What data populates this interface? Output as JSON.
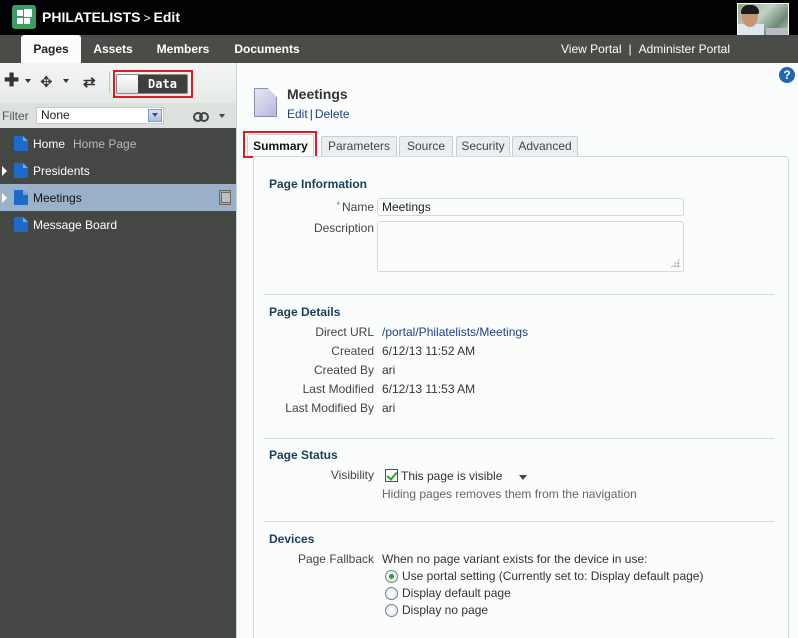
{
  "header": {
    "site_name": "PHILATELISTS",
    "separator": ">",
    "mode": "Edit",
    "logo_icon": "portal-grid-icon",
    "avatar": "user-avatar-photo"
  },
  "nav": {
    "tabs": [
      {
        "label": "Pages",
        "active": true
      },
      {
        "label": "Assets",
        "active": false
      },
      {
        "label": "Members",
        "active": false
      },
      {
        "label": "Documents",
        "active": false
      }
    ],
    "view_portal": "View Portal",
    "divider": "|",
    "administer_portal": "Administer Portal"
  },
  "left_panel": {
    "toolbar": {
      "add_icon": "plus-icon",
      "move_icon": "move-arrows-icon",
      "refresh_icon": "refresh-icon",
      "data_toggle_label": "Data"
    },
    "filter": {
      "label": "Filter",
      "selected": "None",
      "view_icon": "glasses-icon"
    },
    "tree": [
      {
        "label": "Home",
        "sublabel": "Home Page",
        "expandable": false,
        "selected": false
      },
      {
        "label": "Presidents",
        "sublabel": "",
        "expandable": true,
        "selected": false
      },
      {
        "label": "Meetings",
        "sublabel": "",
        "expandable": true,
        "selected": true,
        "device_icon": "device-tablet-icon"
      },
      {
        "label": "Message Board",
        "sublabel": "",
        "expandable": false,
        "selected": false
      }
    ]
  },
  "main": {
    "help_label": "?",
    "page_title": "Meetings",
    "actions": {
      "edit": "Edit",
      "separator": "|",
      "delete": "Delete"
    },
    "tabs": [
      {
        "label": "Summary",
        "active": true
      },
      {
        "label": "Parameters",
        "active": false
      },
      {
        "label": "Source",
        "active": false
      },
      {
        "label": "Security",
        "active": false
      },
      {
        "label": "Advanced",
        "active": false
      }
    ],
    "page_information": {
      "title": "Page Information",
      "required_marker": "*",
      "name_label": "Name",
      "name_value": "Meetings",
      "description_label": "Description",
      "description_value": ""
    },
    "page_details": {
      "title": "Page Details",
      "rows": [
        {
          "label": "Direct URL",
          "value": "/portal/Philatelists/Meetings",
          "link": true
        },
        {
          "label": "Created",
          "value": "6/12/13 11:52 AM",
          "link": false
        },
        {
          "label": "Created By",
          "value": "ari",
          "link": false
        },
        {
          "label": "Last Modified",
          "value": "6/12/13 11:53 AM",
          "link": false
        },
        {
          "label": "Last Modified By",
          "value": "ari",
          "link": false
        }
      ]
    },
    "page_status": {
      "title": "Page Status",
      "visibility_label": "Visibility",
      "visible_checked": true,
      "visible_label": "This page is visible",
      "hint": "Hiding pages removes them from the navigation"
    },
    "devices": {
      "title": "Devices",
      "fallback_label": "Page Fallback",
      "fallback_intro": "When no page variant exists for the device in use:",
      "options": [
        {
          "label": "Use portal setting (Currently set to: Display default page)",
          "selected": true
        },
        {
          "label": "Display default page",
          "selected": false
        },
        {
          "label": "Display no page",
          "selected": false
        }
      ]
    }
  },
  "colors": {
    "topbar": "#020204",
    "navbar": "#4a4c48",
    "left_panel": "#454744",
    "selected_row": "#9bb0c9",
    "section_title": "#1a3d5c",
    "link": "#1f3f8a",
    "highlight": "#e01b24",
    "logo": "#3d9b63"
  }
}
